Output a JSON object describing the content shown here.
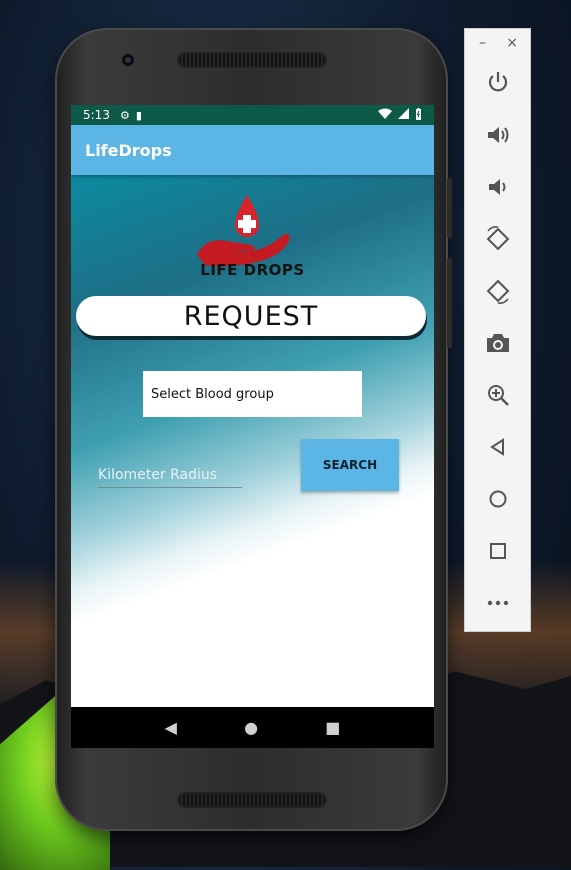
{
  "status_bar": {
    "time": "5:13"
  },
  "app_bar": {
    "title": "LifeDrops"
  },
  "logo": {
    "text": "LIFE DROPS"
  },
  "request_banner": {
    "label": "REQUEST"
  },
  "blood_group_select": {
    "value": "Select Blood group"
  },
  "radius_input": {
    "placeholder": "Kilometer Radius",
    "value": ""
  },
  "search_button": {
    "label": "SEARCH"
  },
  "emulator_panel": {
    "minimize": "–",
    "close": "×",
    "tools": [
      "power-icon",
      "volume-up-icon",
      "volume-down-icon",
      "rotate-left-icon",
      "rotate-right-icon",
      "camera-icon",
      "zoom-icon",
      "back-icon",
      "home-icon",
      "overview-icon",
      "more-icon"
    ]
  },
  "colors": {
    "status_bar": "#0d5a48",
    "app_bar": "#5bb6e6",
    "accent_red": "#d8232a",
    "search_button": "#5bb6e6"
  }
}
